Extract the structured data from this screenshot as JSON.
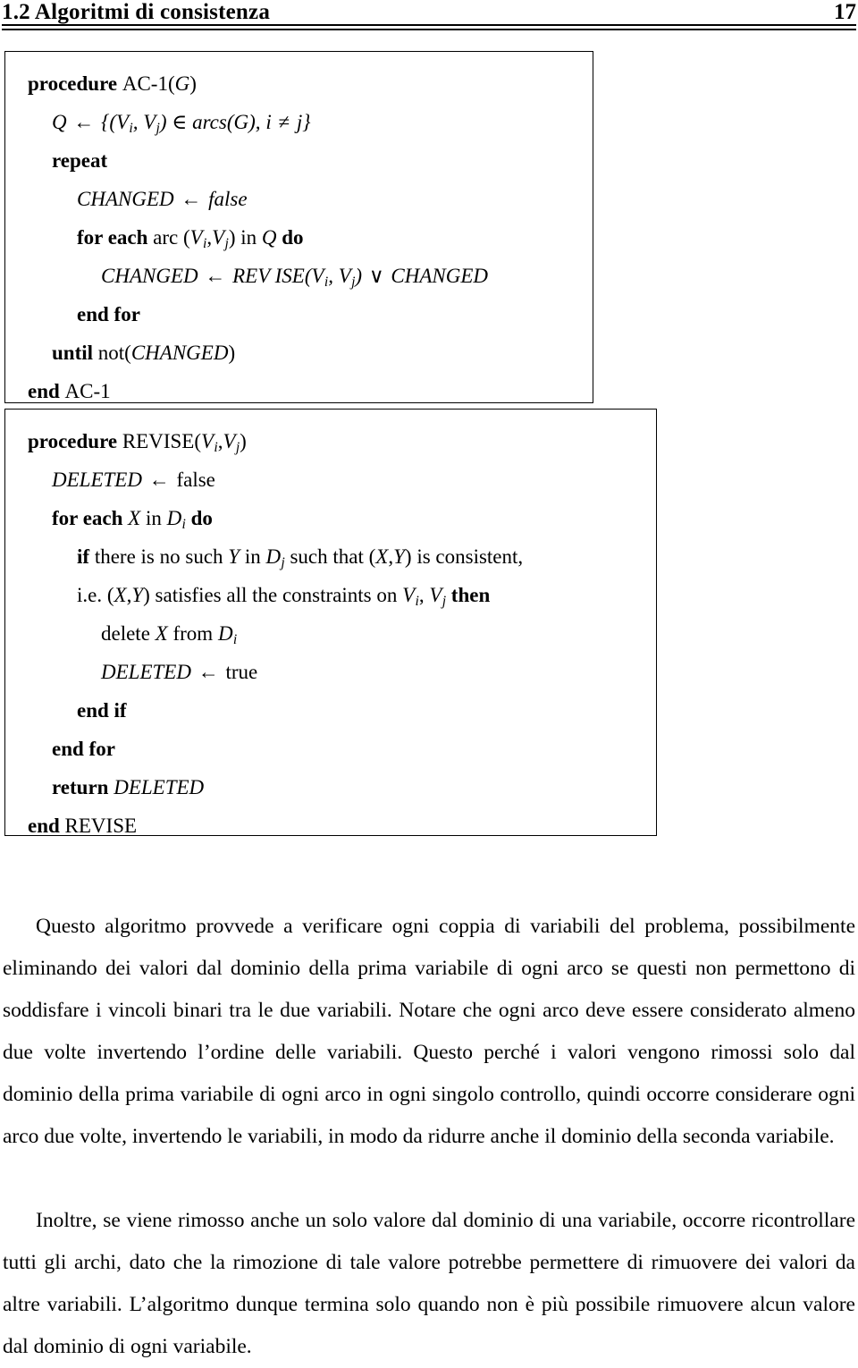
{
  "header": {
    "title": "1.2 Algoritmi di consistenza",
    "page_number": "17"
  },
  "algorithms": [
    {
      "id": "ac-1",
      "name": "AC-1",
      "lines": [
        {
          "indent": 0,
          "segments": [
            {
              "t": "procedure ",
              "s": "kw"
            },
            {
              "t": "AC-1(",
              "s": "rm"
            },
            {
              "t": "G",
              "s": "mvar"
            },
            {
              "t": ")",
              "s": "rm"
            }
          ]
        },
        {
          "indent": 1,
          "segments": [
            {
              "t": "Q",
              "s": "mvar"
            },
            {
              "t": " ← ",
              "s": "op"
            },
            {
              "t": "{(",
              "s": "mth"
            },
            {
              "t": "V",
              "s": "mvar"
            },
            {
              "t": "i",
              "s": "sub"
            },
            {
              "t": ", ",
              "s": "mth"
            },
            {
              "t": "V",
              "s": "mvar"
            },
            {
              "t": "j",
              "s": "sub"
            },
            {
              "t": ") ∈ ",
              "s": "mth"
            },
            {
              "t": "arcs",
              "s": "mth"
            },
            {
              "t": "(",
              "s": "mth"
            },
            {
              "t": "G",
              "s": "mvar"
            },
            {
              "t": "), ",
              "s": "mth"
            },
            {
              "t": "i",
              "s": "mvar"
            },
            {
              "t": " ≠ ",
              "s": "op"
            },
            {
              "t": "j",
              "s": "mvar"
            },
            {
              "t": "}",
              "s": "mth"
            }
          ]
        },
        {
          "indent": 1,
          "segments": [
            {
              "t": "repeat",
              "s": "kw"
            }
          ]
        },
        {
          "indent": 2,
          "segments": [
            {
              "t": "CHANGED",
              "s": "mth"
            },
            {
              "t": " ← ",
              "s": "op"
            },
            {
              "t": "false",
              "s": "mth"
            }
          ]
        },
        {
          "indent": 2,
          "segments": [
            {
              "t": "for each ",
              "s": "kw"
            },
            {
              "t": "arc ",
              "s": "rm"
            },
            {
              "t": "(",
              "s": "rm"
            },
            {
              "t": "V",
              "s": "mvar"
            },
            {
              "t": "i",
              "s": "sub"
            },
            {
              "t": ",",
              "s": "rm"
            },
            {
              "t": "V",
              "s": "mvar"
            },
            {
              "t": "j",
              "s": "sub"
            },
            {
              "t": ") ",
              "s": "rm"
            },
            {
              "t": "in ",
              "s": "rm"
            },
            {
              "t": "Q",
              "s": "mvar"
            },
            {
              "t": " ",
              "s": "rm"
            },
            {
              "t": "do",
              "s": "kw"
            }
          ]
        },
        {
          "indent": 3,
          "segments": [
            {
              "t": "CHANGED",
              "s": "mth"
            },
            {
              "t": " ← ",
              "s": "op"
            },
            {
              "t": "REV ISE",
              "s": "mth"
            },
            {
              "t": "(",
              "s": "mth"
            },
            {
              "t": "V",
              "s": "mvar"
            },
            {
              "t": "i",
              "s": "sub"
            },
            {
              "t": ", ",
              "s": "mth"
            },
            {
              "t": "V",
              "s": "mvar"
            },
            {
              "t": "j",
              "s": "sub"
            },
            {
              "t": ")",
              "s": "mth"
            },
            {
              "t": " ∨ ",
              "s": "op"
            },
            {
              "t": "CHANGED",
              "s": "mth"
            }
          ]
        },
        {
          "indent": 2,
          "segments": [
            {
              "t": "end for",
              "s": "kw"
            }
          ]
        },
        {
          "indent": 1,
          "segments": [
            {
              "t": "until ",
              "s": "kw"
            },
            {
              "t": "not(",
              "s": "rm"
            },
            {
              "t": "CHANGED",
              "s": "mth"
            },
            {
              "t": ")",
              "s": "rm"
            }
          ]
        },
        {
          "indent": 0,
          "segments": [
            {
              "t": "end ",
              "s": "kw"
            },
            {
              "t": "AC-1",
              "s": "rm"
            }
          ]
        }
      ]
    },
    {
      "id": "revise",
      "name": "REVISE",
      "lines": [
        {
          "indent": 0,
          "segments": [
            {
              "t": "procedure ",
              "s": "kw"
            },
            {
              "t": "REVISE(",
              "s": "rm"
            },
            {
              "t": "V",
              "s": "mvar"
            },
            {
              "t": "i",
              "s": "sub"
            },
            {
              "t": ",",
              "s": "rm"
            },
            {
              "t": "V",
              "s": "mvar"
            },
            {
              "t": "j",
              "s": "sub"
            },
            {
              "t": ")",
              "s": "rm"
            }
          ]
        },
        {
          "indent": 1,
          "segments": [
            {
              "t": "DELETED",
              "s": "mth"
            },
            {
              "t": " ← ",
              "s": "op"
            },
            {
              "t": "false",
              "s": "rm"
            }
          ]
        },
        {
          "indent": 1,
          "segments": [
            {
              "t": "for each ",
              "s": "kw"
            },
            {
              "t": "X",
              "s": "mvar"
            },
            {
              "t": " in ",
              "s": "rm"
            },
            {
              "t": "D",
              "s": "mvar"
            },
            {
              "t": "i",
              "s": "sub"
            },
            {
              "t": " ",
              "s": "rm"
            },
            {
              "t": "do",
              "s": "kw"
            }
          ]
        },
        {
          "indent": 2,
          "segments": [
            {
              "t": "if ",
              "s": "kw"
            },
            {
              "t": "there is no such ",
              "s": "rm"
            },
            {
              "t": "Y",
              "s": "mvar"
            },
            {
              "t": " in ",
              "s": "rm"
            },
            {
              "t": "D",
              "s": "mvar"
            },
            {
              "t": "j",
              "s": "sub"
            },
            {
              "t": " such that (",
              "s": "rm"
            },
            {
              "t": "X",
              "s": "mvar"
            },
            {
              "t": ",",
              "s": "rm"
            },
            {
              "t": "Y",
              "s": "mvar"
            },
            {
              "t": ") is consistent,",
              "s": "rm"
            }
          ]
        },
        {
          "indent": 2,
          "segments": [
            {
              "t": "i.e. (",
              "s": "rm"
            },
            {
              "t": "X",
              "s": "mvar"
            },
            {
              "t": ",",
              "s": "rm"
            },
            {
              "t": "Y",
              "s": "mvar"
            },
            {
              "t": ") satisfies all the constraints on ",
              "s": "rm"
            },
            {
              "t": "V",
              "s": "mvar"
            },
            {
              "t": "i",
              "s": "sub"
            },
            {
              "t": ", ",
              "s": "rm"
            },
            {
              "t": "V",
              "s": "mvar"
            },
            {
              "t": "j",
              "s": "sub"
            },
            {
              "t": " ",
              "s": "rm"
            },
            {
              "t": "then",
              "s": "kw"
            }
          ]
        },
        {
          "indent": 3,
          "segments": [
            {
              "t": "delete ",
              "s": "rm"
            },
            {
              "t": "X",
              "s": "mvar"
            },
            {
              "t": " from ",
              "s": "rm"
            },
            {
              "t": "D",
              "s": "mvar"
            },
            {
              "t": "i",
              "s": "sub"
            }
          ]
        },
        {
          "indent": 3,
          "segments": [
            {
              "t": "DELETED",
              "s": "mth"
            },
            {
              "t": " ← ",
              "s": "op"
            },
            {
              "t": "true",
              "s": "rm"
            }
          ]
        },
        {
          "indent": 2,
          "segments": [
            {
              "t": "end if",
              "s": "kw"
            }
          ]
        },
        {
          "indent": 1,
          "segments": [
            {
              "t": "end for",
              "s": "kw"
            }
          ]
        },
        {
          "indent": 1,
          "segments": [
            {
              "t": "return ",
              "s": "kw"
            },
            {
              "t": "DELETED",
              "s": "mth"
            }
          ]
        },
        {
          "indent": 0,
          "segments": [
            {
              "t": "end ",
              "s": "kw"
            },
            {
              "t": "REVISE",
              "s": "rm"
            }
          ]
        }
      ]
    }
  ],
  "paragraphs": {
    "p1": "Questo algoritmo provvede a verificare ogni coppia di variabili del problema, possibilmente eliminando dei valori dal dominio della prima variabile di ogni arco se questi non permettono di soddisfare i vincoli binari tra le due variabili. Notare che ogni arco deve essere considerato almeno due volte invertendo l’ordine delle variabili. Questo perché i valori vengono rimossi solo dal dominio della prima variabile di ogni arco in ogni singolo controllo, quindi occorre considerare ogni arco due volte, invertendo le variabili, in modo da ridurre anche il dominio della seconda variabile.",
    "p2": "Inoltre, se viene rimosso anche un solo valore dal dominio di una variabile, occorre ricontrollare tutti gli archi, dato che la rimozione di tale valore potrebbe permettere di rimuovere dei valori da altre variabili. L’algoritmo dunque termina solo quando non è più possibile rimuovere alcun valore dal dominio di ogni variabile."
  }
}
